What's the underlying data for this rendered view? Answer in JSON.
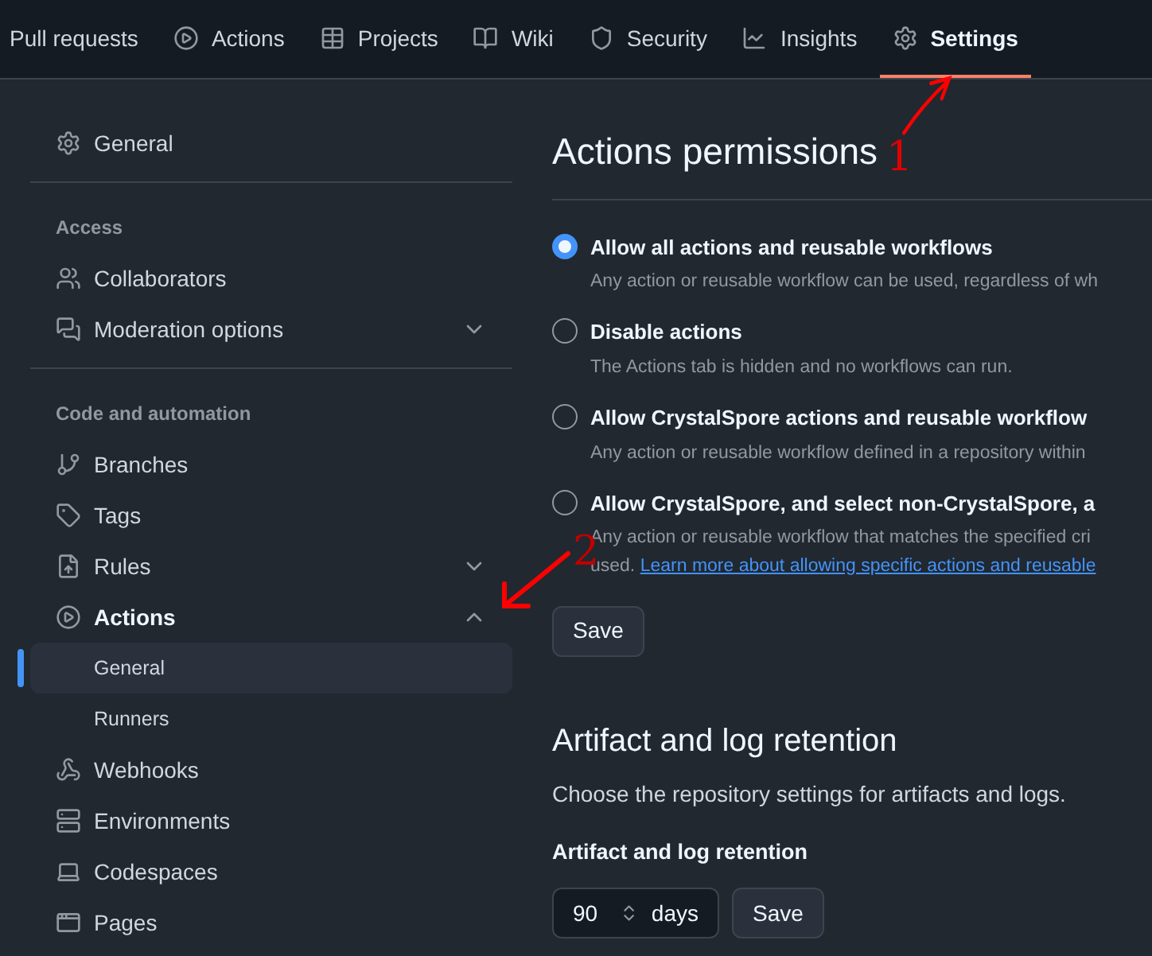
{
  "nav": {
    "tabs": [
      {
        "label": "Pull requests",
        "selected": false
      },
      {
        "label": "Actions",
        "selected": false
      },
      {
        "label": "Projects",
        "selected": false
      },
      {
        "label": "Wiki",
        "selected": false
      },
      {
        "label": "Security",
        "selected": false
      },
      {
        "label": "Insights",
        "selected": false
      },
      {
        "label": "Settings",
        "selected": true
      }
    ]
  },
  "sidebar": {
    "groups": [
      {
        "items": [
          {
            "label": "General",
            "selected": false
          }
        ]
      },
      {
        "heading": "Access",
        "items": [
          {
            "label": "Collaborators",
            "selected": false
          },
          {
            "label": "Moderation options",
            "selected": false,
            "expanded": false
          }
        ]
      },
      {
        "heading": "Code and automation",
        "items": [
          {
            "label": "Branches",
            "selected": false
          },
          {
            "label": "Tags",
            "selected": false
          },
          {
            "label": "Rules",
            "selected": false,
            "expanded": false
          },
          {
            "label": "Actions",
            "selected": false,
            "expanded": true,
            "children": [
              {
                "label": "General",
                "selected": true
              },
              {
                "label": "Runners",
                "selected": false
              }
            ]
          },
          {
            "label": "Webhooks",
            "selected": false
          },
          {
            "label": "Environments",
            "selected": false
          },
          {
            "label": "Codespaces",
            "selected": false
          },
          {
            "label": "Pages",
            "selected": false
          }
        ]
      }
    ]
  },
  "permissions": {
    "title": "Actions permissions",
    "options": [
      {
        "label": "Allow all actions and reusable workflows",
        "description": "Any action or reusable workflow can be used, regardless of wh",
        "selected": true
      },
      {
        "label": "Disable actions",
        "description": "The Actions tab is hidden and no workflows can run.",
        "selected": false
      },
      {
        "label": "Allow CrystalSpore actions and reusable workflow",
        "description": "Any action or reusable workflow defined in a repository within",
        "selected": false
      },
      {
        "label": "Allow CrystalSpore, and select non-CrystalSpore, a",
        "description": "Any action or reusable workflow that matches the specified cri",
        "description_end": "used.",
        "link": "Learn more about allowing specific actions and reusable",
        "selected": false
      }
    ],
    "save": "Save"
  },
  "retention": {
    "title": "Artifact and log retention",
    "description": "Choose the repository settings for artifacts and logs.",
    "field_label": "Artifact and log retention",
    "value": "90",
    "unit": "days",
    "save": "Save"
  },
  "annotations": [
    {
      "label": "1"
    },
    {
      "label": "2"
    }
  ]
}
